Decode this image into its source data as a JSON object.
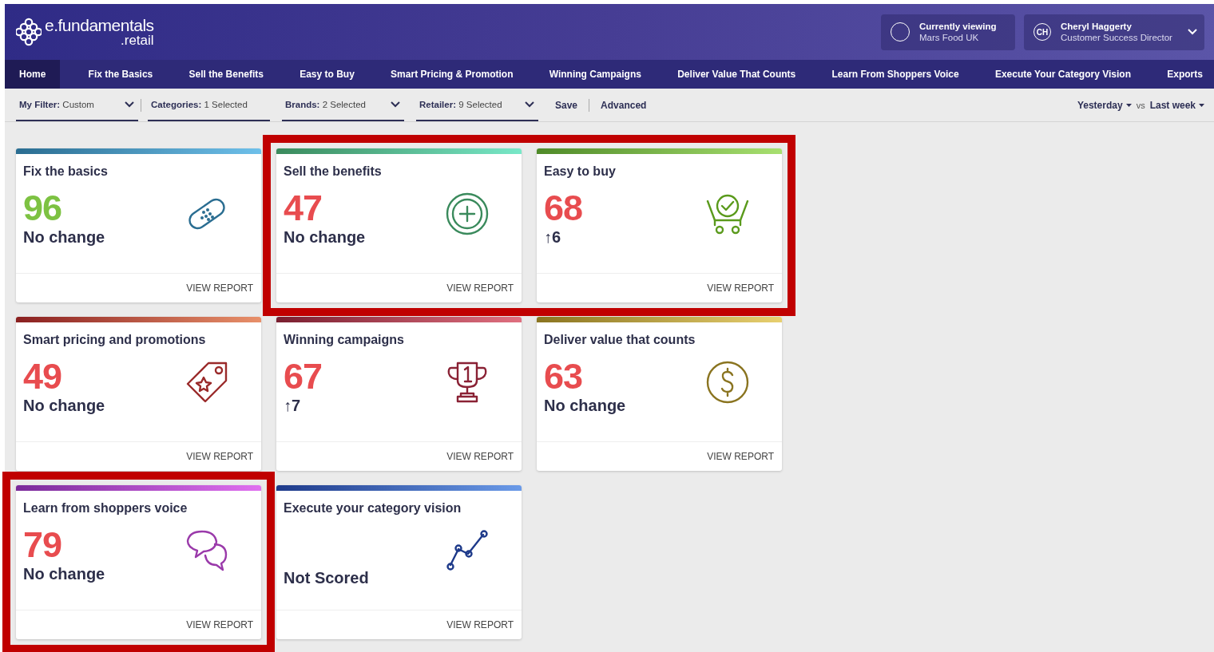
{
  "brand": {
    "name": "e.fundamentals",
    "suffix": ".retail"
  },
  "viewing": {
    "label": "Currently viewing",
    "value": "Mars Food UK"
  },
  "user": {
    "initials": "CH",
    "name": "Cheryl Haggerty",
    "role": "Customer Success Director"
  },
  "nav": [
    {
      "label": "Home",
      "selected": true
    },
    {
      "label": "Fix the Basics",
      "selected": false
    },
    {
      "label": "Sell the Benefits",
      "selected": false
    },
    {
      "label": "Easy to Buy",
      "selected": false
    },
    {
      "label": "Smart Pricing & Promotion",
      "selected": false
    },
    {
      "label": "Winning Campaigns",
      "selected": false
    },
    {
      "label": "Deliver Value That Counts",
      "selected": false
    },
    {
      "label": "Learn From Shoppers Voice",
      "selected": false
    },
    {
      "label": "Execute Your Category Vision",
      "selected": false
    },
    {
      "label": "Exports",
      "selected": false
    }
  ],
  "filters": [
    {
      "label": "My Filter:",
      "value": "Custom",
      "dropdown": true
    },
    {
      "label": "Categories:",
      "value": "1 Selected",
      "dropdown": false
    },
    {
      "label": "Brands:",
      "value": "2 Selected",
      "dropdown": true
    },
    {
      "label": "Retailer:",
      "value": "9 Selected",
      "dropdown": true
    }
  ],
  "actions": [
    "Save",
    "Advanced"
  ],
  "period": {
    "current": "Yesterday",
    "vs": "vs",
    "compare": "Last week"
  },
  "cards": [
    {
      "kind": "bandage",
      "title": "Fix the basics",
      "score": "96",
      "color": "#7dc242",
      "change": "No change",
      "highlighted": false,
      "link": "VIEW REPORT"
    },
    {
      "kind": "plus",
      "title": "Sell the benefits",
      "score": "47",
      "color": "#e84c4f",
      "change": "No change",
      "highlighted": true,
      "link": "VIEW REPORT"
    },
    {
      "kind": "cart",
      "title": "Easy to buy",
      "score": "68",
      "color": "#e84c4f",
      "change": "↑6",
      "highlighted": true,
      "link": "VIEW REPORT"
    },
    {
      "kind": "tag",
      "title": "Smart pricing and promotions",
      "score": "49",
      "color": "#e84c4f",
      "change": "No change",
      "highlighted": false,
      "link": "VIEW REPORT"
    },
    {
      "kind": "trophy",
      "title": "Winning campaigns",
      "score": "67",
      "color": "#e84c4f",
      "change": "↑7",
      "highlighted": false,
      "link": "VIEW REPORT"
    },
    {
      "kind": "dollar",
      "title": "Deliver value that counts",
      "score": "63",
      "color": "#e84c4f",
      "change": "No change",
      "highlighted": false,
      "link": "VIEW REPORT"
    },
    {
      "kind": "chat",
      "title": "Learn from shoppers voice",
      "score": "79",
      "color": "#e84c4f",
      "change": "No change",
      "highlighted": true,
      "link": "VIEW REPORT"
    },
    {
      "kind": "line",
      "title": "Execute your category vision",
      "change": "Not Scored",
      "highlighted": false,
      "link": "VIEW REPORT"
    }
  ]
}
